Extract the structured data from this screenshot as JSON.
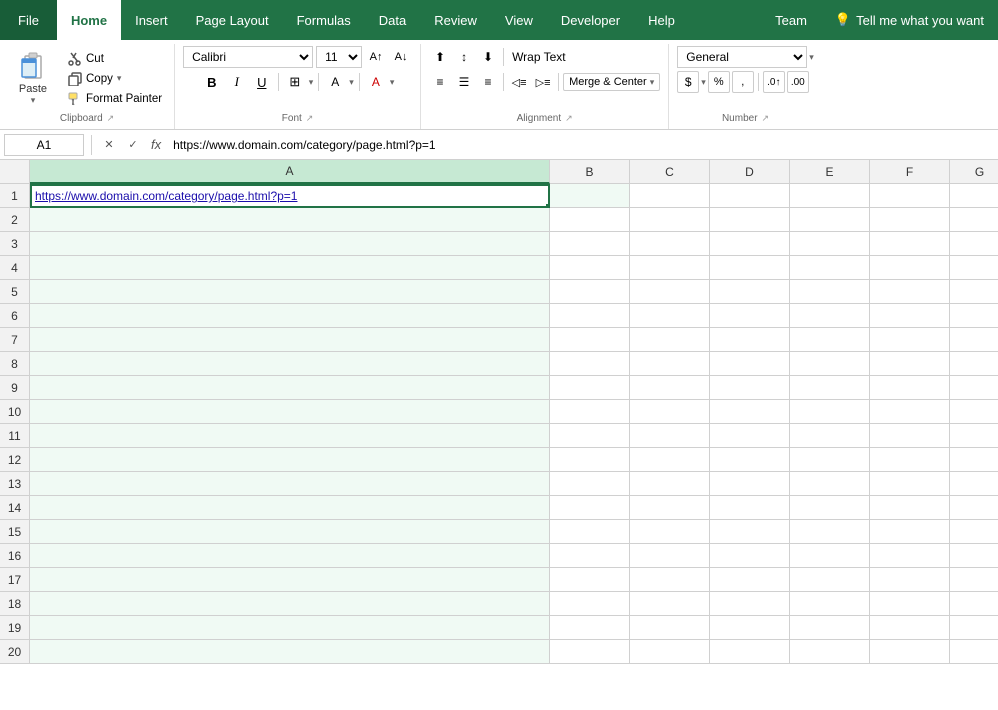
{
  "menubar": {
    "file": "File",
    "tabs": [
      "Home",
      "Insert",
      "Page Layout",
      "Formulas",
      "Data",
      "Review",
      "View",
      "Developer",
      "Help",
      "Team"
    ],
    "active_tab": "Home",
    "tell_me": "Tell me what you want",
    "lightbulb": "💡"
  },
  "ribbon": {
    "clipboard": {
      "paste_label": "Paste",
      "cut_label": "Cut",
      "copy_label": "Copy",
      "format_painter_label": "Format Painter",
      "group_label": "Clipboard"
    },
    "font": {
      "font_name": "Calibri",
      "font_size": "11",
      "bold": "B",
      "italic": "I",
      "underline": "U",
      "group_label": "Font"
    },
    "alignment": {
      "wrap_text_label": "Wrap Text",
      "merge_center_label": "Merge & Center",
      "group_label": "Alignment"
    },
    "number": {
      "format": "General",
      "group_label": "Number",
      "percent": "%",
      "comma": ",",
      "increase_decimal": ".0",
      "decrease_decimal": ".00"
    }
  },
  "formula_bar": {
    "cell_ref": "A1",
    "formula": "https://www.domain.com/category/page.html?p=1",
    "cancel_label": "✕",
    "confirm_label": "✓",
    "fx_label": "fx"
  },
  "grid": {
    "columns": [
      "A",
      "B",
      "C",
      "D",
      "E",
      "F",
      "G"
    ],
    "active_cell": "A1",
    "active_col": "A",
    "cell_a1_value": "https://www.domain.com/category/page.html?p=1",
    "row_count": 20
  }
}
